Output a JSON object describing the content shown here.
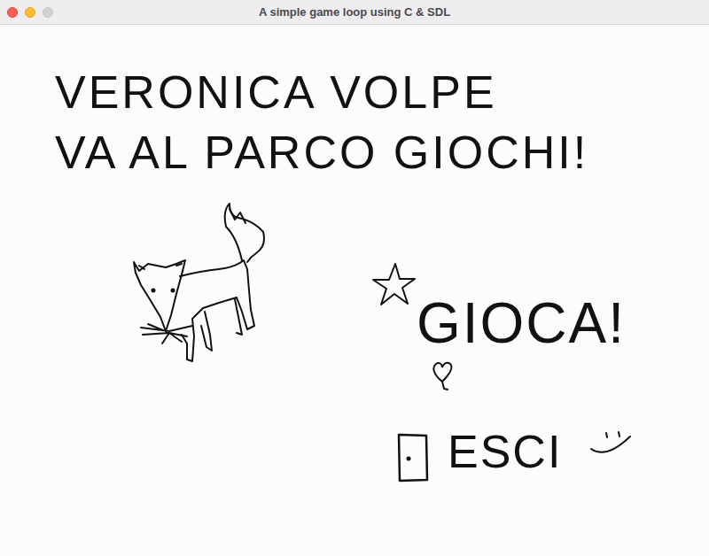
{
  "window": {
    "title": "A simple game loop using C & SDL",
    "zoom_enabled": false
  },
  "title_lines": [
    "VERONICA VOLPE",
    "VA AL PARCO GIOCHI!"
  ],
  "play_button": {
    "label": "GIOCA!"
  },
  "quit_button": {
    "label": "ESCI"
  }
}
